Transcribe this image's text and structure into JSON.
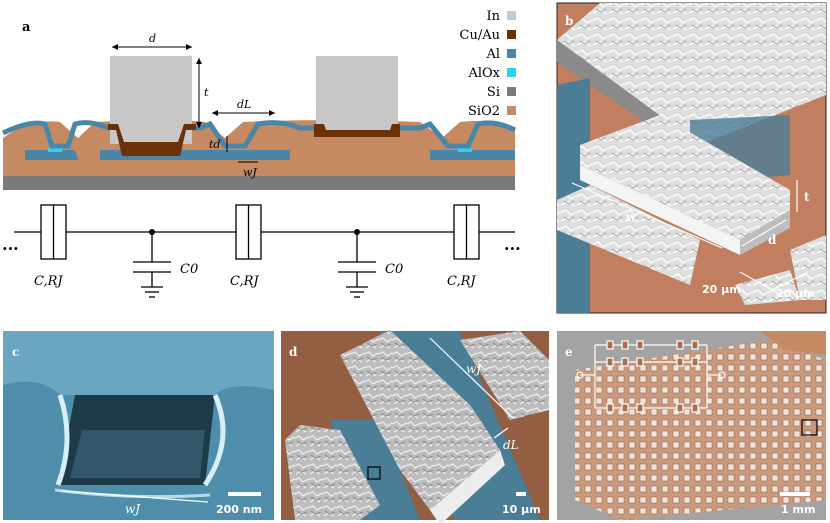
{
  "panels": {
    "a": "a",
    "b": "b",
    "c": "c",
    "d": "d",
    "e": "e"
  },
  "legend": [
    {
      "label": "In",
      "color": "#c8c8c8"
    },
    {
      "label": "Cu/Au",
      "color": "#6b3208"
    },
    {
      "label": "Al",
      "color": "#4a86a8"
    },
    {
      "label": "AlOx",
      "color": "#2ad4f0"
    },
    {
      "label": "Si",
      "color": "#7a7a7a"
    },
    {
      "label": "SiO2",
      "color": "#c58a62"
    }
  ],
  "cross_section_labels": {
    "d": "d",
    "t": "t",
    "dL": "dL",
    "td": "td",
    "wJ": "wJ"
  },
  "circuit_labels": {
    "junction": "C,RJ",
    "cap": "C0",
    "ellipsis_left": "...",
    "ellipsis_right": "..."
  },
  "panel_b": {
    "w": "w",
    "d": "d",
    "t": "t",
    "scalebar": "20 µm"
  },
  "panel_c": {
    "wJ": "wJ",
    "scalebar": "200 nm"
  },
  "panel_d": {
    "wJ": "wJ",
    "dL": "dL",
    "scalebar": "10 µm"
  },
  "panel_e": {
    "scalebar": "1 mm"
  }
}
